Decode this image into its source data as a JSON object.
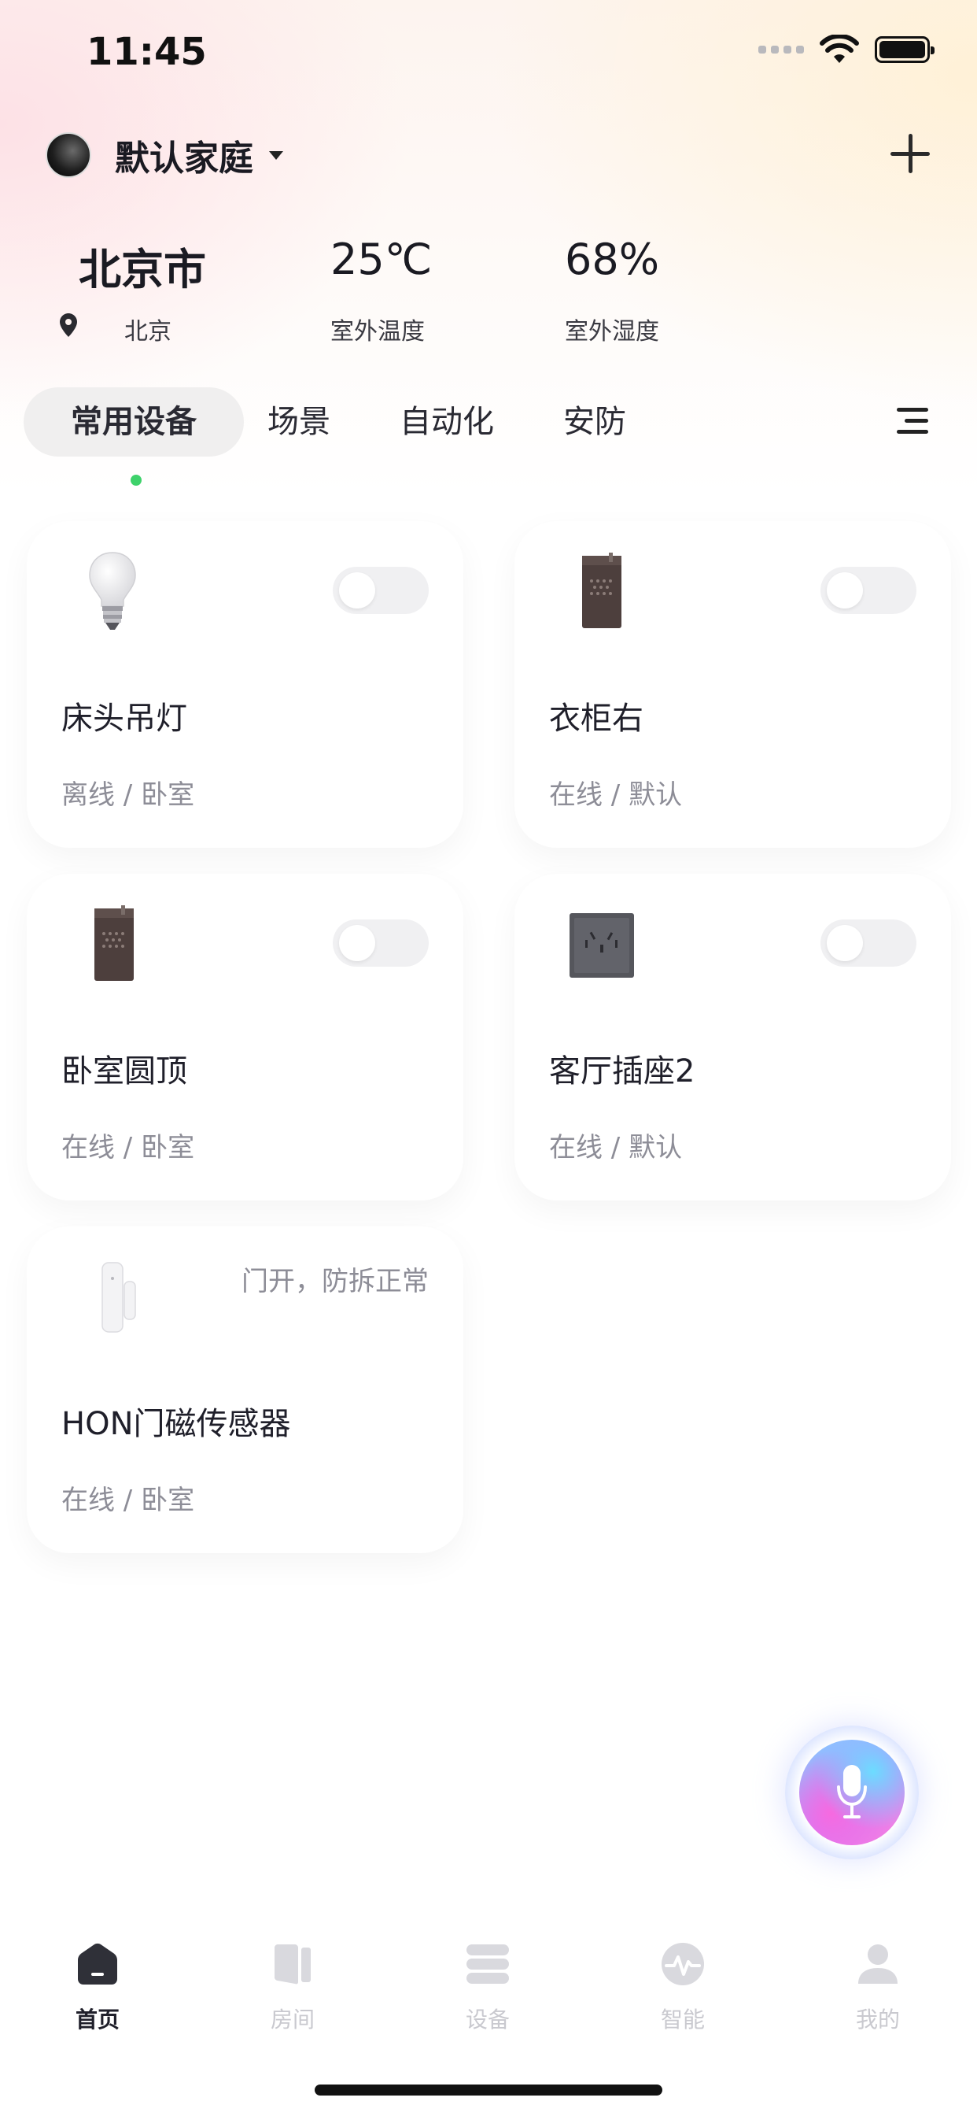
{
  "status_bar": {
    "time": "11:45"
  },
  "header": {
    "home_name": "默认家庭",
    "icons": [
      "avatar",
      "caret-down-icon",
      "plus-icon"
    ]
  },
  "environment": {
    "city": "北京市",
    "location": "北京",
    "temperature": "25℃",
    "temperature_label": "室外温度",
    "humidity": "68%",
    "humidity_label": "室外湿度"
  },
  "tabs": [
    {
      "label": "常用设备",
      "active": true
    },
    {
      "label": "场景",
      "active": false
    },
    {
      "label": "自动化",
      "active": false
    },
    {
      "label": "安防",
      "active": false
    }
  ],
  "devices": [
    {
      "name": "床头吊灯",
      "status": "离线 / 卧室",
      "icon": "light-bulb-icon",
      "toggle": false
    },
    {
      "name": "衣柜右",
      "status": "在线 / 默认",
      "icon": "switch-panel-icon",
      "toggle": false
    },
    {
      "name": "卧室圆顶",
      "status": "在线 / 卧室",
      "icon": "switch-panel-icon",
      "toggle": false
    },
    {
      "name": "客厅插座2",
      "status": "在线 / 默认",
      "icon": "socket-icon",
      "toggle": false
    },
    {
      "name": "HON门磁传感器",
      "status": "在线 / 卧室",
      "icon": "door-sensor-icon",
      "state_text": "门开，防拆正常"
    }
  ],
  "bottom_nav": [
    {
      "label": "首页",
      "active": true,
      "icon": "home-icon"
    },
    {
      "label": "房间",
      "active": false,
      "icon": "room-icon"
    },
    {
      "label": "设备",
      "active": false,
      "icon": "device-icon"
    },
    {
      "label": "智能",
      "active": false,
      "icon": "smart-icon"
    },
    {
      "label": "我的",
      "active": false,
      "icon": "profile-icon"
    }
  ],
  "colors": {
    "active_dot": "#3ed26b",
    "text_primary": "#1f1f2a",
    "text_secondary": "#8d8d97",
    "tab_inactive": "#c9c9cf"
  }
}
